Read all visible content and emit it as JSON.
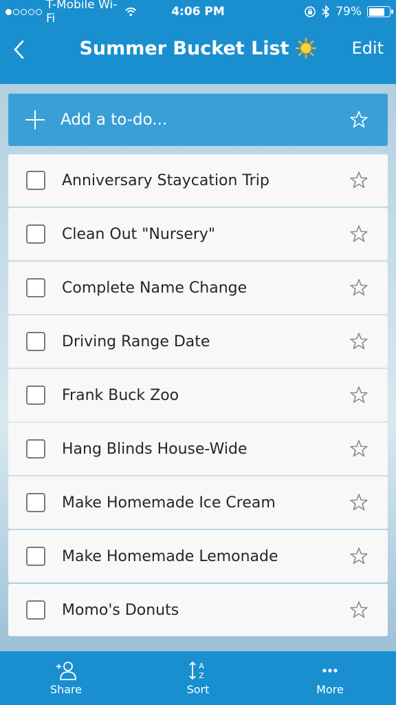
{
  "status_bar": {
    "carrier": "T-Mobile Wi-Fi",
    "time": "4:06 PM",
    "battery": "79%",
    "battery_level": 0.79,
    "signal_bars_filled": 1,
    "signal_bars_total": 5
  },
  "nav": {
    "back_icon": "chevron-left-icon",
    "title": "Summer Bucket List",
    "title_icon": "sun-icon",
    "edit_label": "Edit"
  },
  "add_todo": {
    "placeholder": "Add a to-do...",
    "plus_icon": "plus-icon",
    "star_icon": "star-outline-icon"
  },
  "todos": [
    {
      "label": "Anniversary Staycation Trip"
    },
    {
      "label": "Clean Out \"Nursery\""
    },
    {
      "label": "Complete Name Change"
    },
    {
      "label": "Driving Range Date"
    },
    {
      "label": "Frank Buck Zoo"
    },
    {
      "label": "Hang Blinds House-Wide"
    },
    {
      "label": "Make Homemade Ice Cream"
    },
    {
      "label": "Make Homemade Lemonade"
    },
    {
      "label": "Momo's Donuts"
    }
  ],
  "tab_bar": {
    "share_label": "Share",
    "sort_label": "Sort",
    "more_label": "More"
  },
  "colors": {
    "primary": "#1a8fd0",
    "add_row": "#3a9fd6",
    "item_bg": "#f8f8f8",
    "text": "#262626"
  }
}
